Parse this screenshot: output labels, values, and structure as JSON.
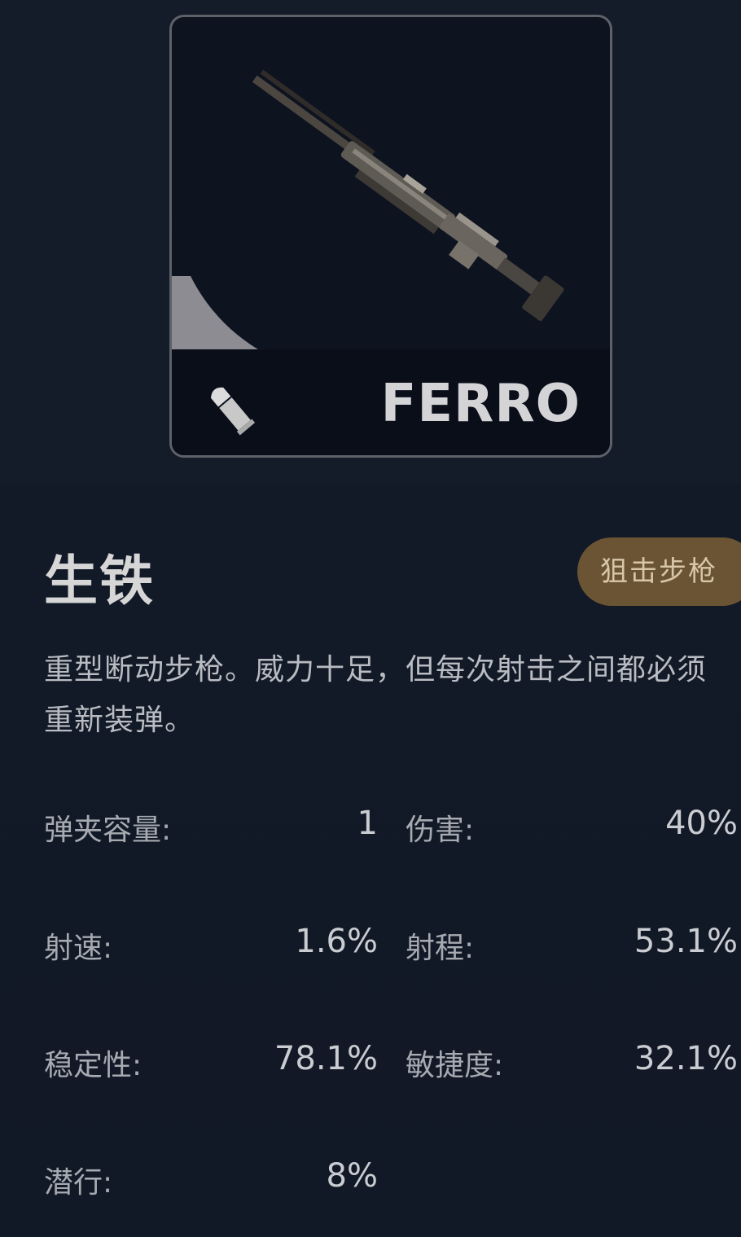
{
  "card": {
    "name": "FERRO",
    "weapon_image_icon": "rifle-image",
    "ammo_icon": "bullet-icon"
  },
  "weapon": {
    "title": "生铁",
    "type_badge": "狙击步枪",
    "description": "重型断动步枪。威力十足，但每次射击之间都必须重新装弹。"
  },
  "stats": {
    "magazine_label": "弹夹容量:",
    "magazine_value": "1",
    "damage_label": "伤害:",
    "damage_value": "40%",
    "fire_rate_label": "射速:",
    "fire_rate_value": "1.6%",
    "range_label": "射程:",
    "range_value": "53.1%",
    "stability_label": "稳定性:",
    "stability_value": "78.1%",
    "agility_label": "敏捷度:",
    "agility_value": "32.1%",
    "stealth_label": "潜行:",
    "stealth_value": "8%"
  },
  "colors": {
    "background": "#131a27",
    "badge": "#6b5434",
    "card_border": "#5d6168"
  }
}
